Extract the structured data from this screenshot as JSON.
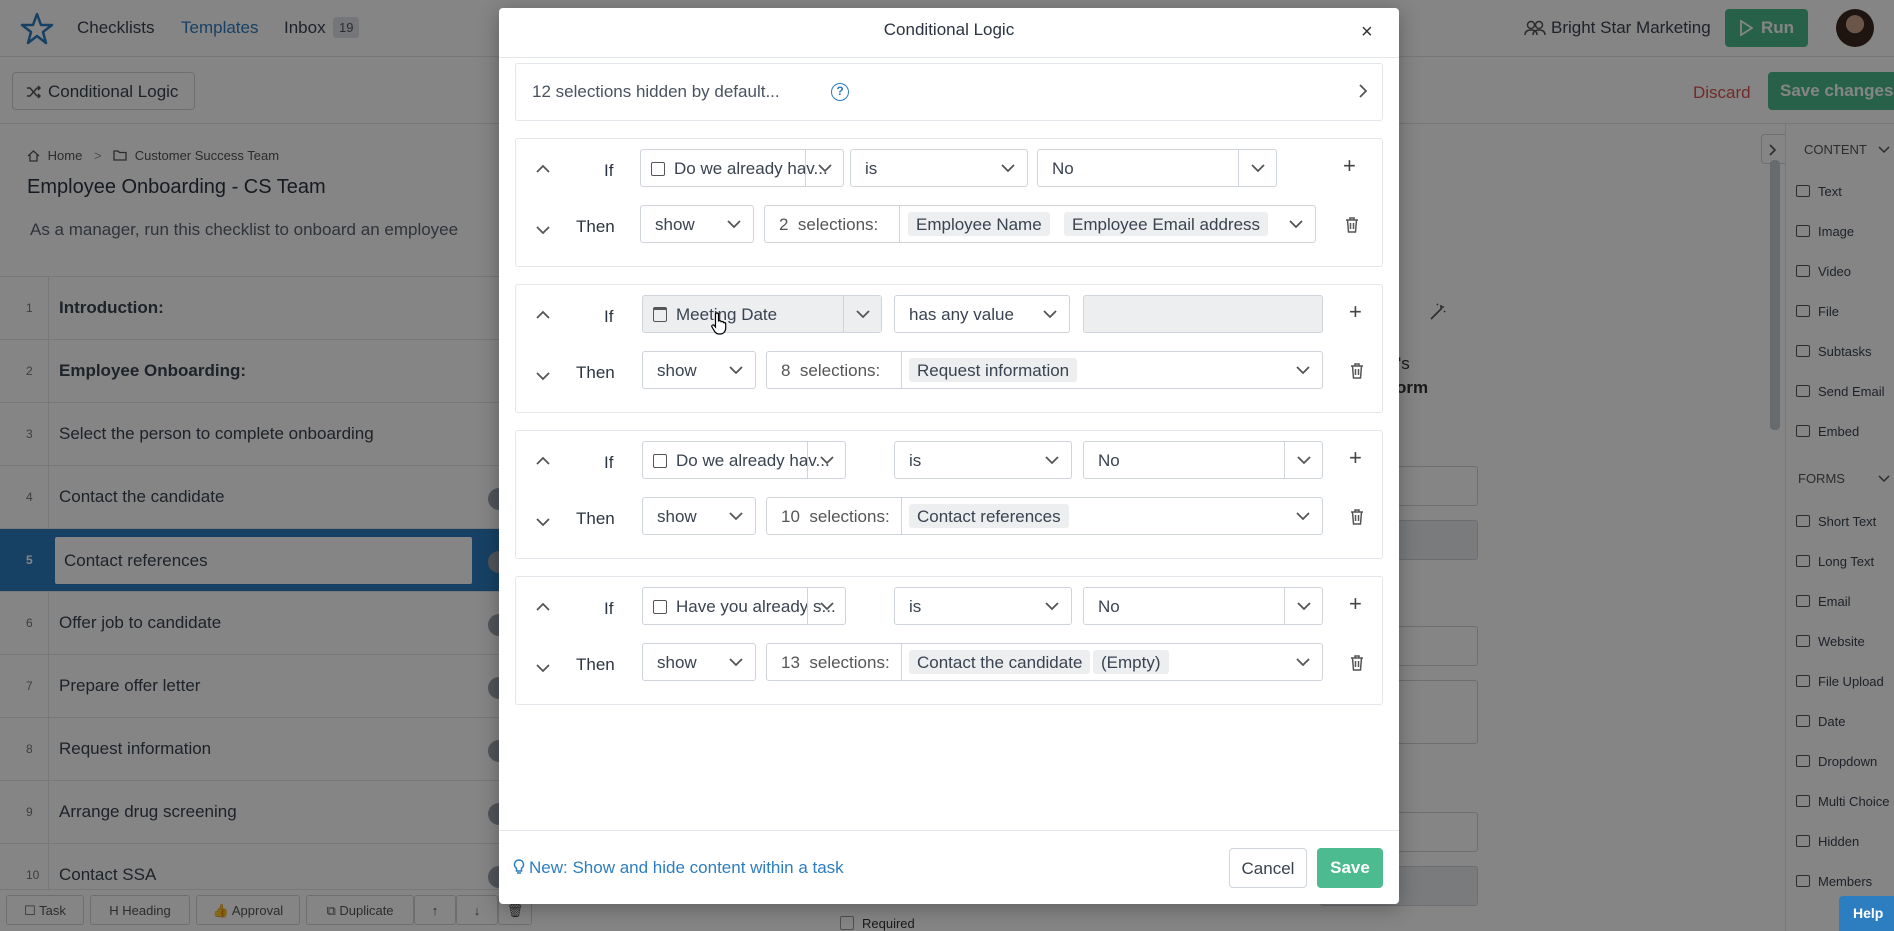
{
  "nav": {
    "checklists": "Checklists",
    "templates": "Templates",
    "inbox": "Inbox",
    "inbox_count": "19",
    "org": "Bright Star Marketing",
    "run": "Run"
  },
  "toolbar": {
    "conditional_logic": "Conditional Logic",
    "discard": "Discard",
    "save_changes": "Save changes"
  },
  "breadcrumb": {
    "home": "Home",
    "folder": "Customer Success Team"
  },
  "template": {
    "title": "Employee Onboarding - CS Team",
    "description": "As a manager, run this checklist to onboard an employee"
  },
  "tasks": [
    {
      "num": "1",
      "label": "Introduction:"
    },
    {
      "num": "2",
      "label": "Employee Onboarding:"
    },
    {
      "num": "3",
      "label": "Select the person to complete onboarding"
    },
    {
      "num": "4",
      "label": "Contact the candidate"
    },
    {
      "num": "5",
      "label": "Contact references"
    },
    {
      "num": "6",
      "label": "Offer job to candidate"
    },
    {
      "num": "7",
      "label": "Prepare offer letter"
    },
    {
      "num": "8",
      "label": "Request information"
    },
    {
      "num": "9",
      "label": "Arrange drug screening"
    },
    {
      "num": "10",
      "label": "Contact SSA"
    }
  ],
  "bottom_toolbar": {
    "task": "Task",
    "heading": "Heading",
    "approval": "Approval",
    "duplicate": "Duplicate"
  },
  "sidebar": {
    "content_head": "CONTENT",
    "content": [
      "Text",
      "Image",
      "Video",
      "File",
      "Subtasks",
      "Send Email",
      "Embed"
    ],
    "forms_head": "FORMS",
    "forms": [
      "Short Text",
      "Long Text",
      "Email",
      "Website",
      "File Upload",
      "Date",
      "Dropdown",
      "Multi Choice",
      "Hidden",
      "Members"
    ],
    "help": "Help"
  },
  "background": {
    "partial1": "'s",
    "partial2": "orm",
    "required": "Required"
  },
  "modal": {
    "title": "Conditional Logic",
    "hidden_note": "12 selections hidden by default...",
    "rules": [
      {
        "if_label": "If",
        "then_label": "Then",
        "field": "Do we already hav...",
        "operator": "is",
        "value": "No",
        "action": "show",
        "count": "2",
        "count_suffix": "selections:",
        "chips": [
          "Employee Name",
          "Employee Email address"
        ]
      },
      {
        "if_label": "If",
        "then_label": "Then",
        "field": "Meeting Date",
        "operator": "has any value",
        "value": "",
        "action": "show",
        "count": "8",
        "count_suffix": "selections:",
        "chips": [
          "Request information"
        ]
      },
      {
        "if_label": "If",
        "then_label": "Then",
        "field": "Do we already hav...",
        "operator": "is",
        "value": "No",
        "action": "show",
        "count": "10",
        "count_suffix": "selections:",
        "chips": [
          "Contact references"
        ]
      },
      {
        "if_label": "If",
        "then_label": "Then",
        "field": "Have you already s...",
        "operator": "is",
        "value": "No",
        "action": "show",
        "count": "13",
        "count_suffix": "selections:",
        "chips": [
          "Contact the candidate",
          "(Empty)"
        ]
      }
    ],
    "tip": "New: Show and hide content within a task",
    "cancel": "Cancel",
    "save": "Save"
  },
  "colors": {
    "accent": "#2d7ec0",
    "primary_green": "#4cbb8f",
    "danger": "#d9534f"
  }
}
